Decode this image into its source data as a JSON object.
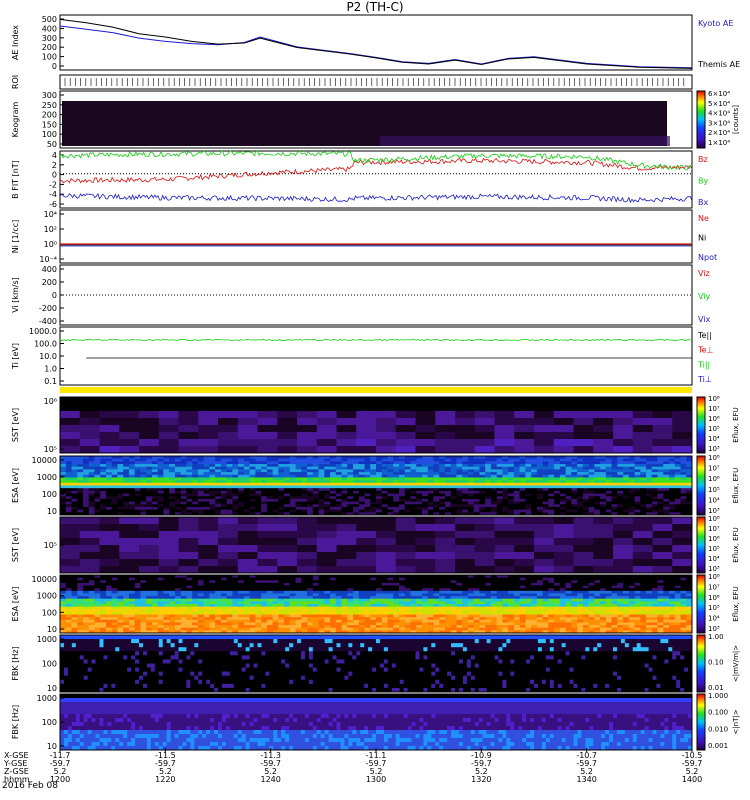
{
  "title": "P2 (TH-C)",
  "date_label": "2016 Feb 08",
  "footer": {
    "row_labels": [
      "X-GSE",
      "Y-GSE",
      "Z-GSE",
      "hhmm"
    ],
    "ticks": [
      {
        "time": "1200",
        "x": "-11.7",
        "y": "-59.7",
        "z": "5.2"
      },
      {
        "time": "1220",
        "x": "-11.5",
        "y": "-59.7",
        "z": "5.2"
      },
      {
        "time": "1240",
        "x": "-11.3",
        "y": "-59.7",
        "z": "5.2"
      },
      {
        "time": "1300",
        "x": "-11.1",
        "y": "-59.7",
        "z": "5.2"
      },
      {
        "time": "1320",
        "x": "-10.9",
        "y": "-59.7",
        "z": "5.2"
      },
      {
        "time": "1340",
        "x": "-10.7",
        "y": "-59.7",
        "z": "5.2"
      },
      {
        "time": "1400",
        "x": "-10.5",
        "y": "-59.7",
        "z": "5.2"
      }
    ]
  },
  "colors": {
    "black": "#000000",
    "blue": "#1a1ad0",
    "red": "#e01010",
    "green": "#10d010"
  },
  "chart_data": [
    {
      "id": "ae",
      "type": "line",
      "ylabel": "AE Index",
      "ylim": [
        0,
        500
      ],
      "ticks": [
        "0",
        "100",
        "200",
        "300",
        "400",
        "500"
      ],
      "legend": [
        {
          "name": "Kyoto AE",
          "color": "#1a1ad0"
        },
        {
          "name": "Themis AE",
          "color": "#000000"
        }
      ],
      "x_minutes": [
        0,
        5,
        10,
        15,
        20,
        25,
        30,
        35,
        38,
        45,
        50,
        55,
        60,
        65,
        70,
        75,
        80,
        85,
        90,
        100,
        110,
        120
      ],
      "series": [
        {
          "name": "Kyoto AE",
          "values": [
            400,
            370,
            340,
            290,
            260,
            240,
            230,
            250,
            300,
            210,
            180,
            150,
            115,
            75,
            60,
            95,
            55,
            105,
            120,
            60,
            30,
            20
          ]
        },
        {
          "name": "Themis AE",
          "values": [
            460,
            430,
            390,
            330,
            300,
            260,
            235,
            245,
            290,
            205,
            175,
            145,
            110,
            70,
            55,
            90,
            50,
            100,
            115,
            55,
            25,
            15
          ]
        }
      ]
    },
    {
      "id": "roi",
      "type": "bar",
      "ylabel": "ROI",
      "note": "tick marks only"
    },
    {
      "id": "keogram",
      "type": "heatmap",
      "ylabel": "Keogram",
      "ylim": [
        0,
        300
      ],
      "ticks": [
        "50",
        "100",
        "150",
        "200",
        "250",
        "300"
      ],
      "colorbar": {
        "label": "[counts]",
        "ticks": [
          "1×10⁴",
          "2×10⁴",
          "3×10⁴",
          "4×10⁴",
          "5×10⁴",
          "6×10⁴"
        ]
      },
      "end_minute": 120
    },
    {
      "id": "bfield",
      "type": "line",
      "ylabel": "B FIT",
      "unit": "[nT]",
      "ylim": [
        -6,
        4
      ],
      "ticks": [
        "-6",
        "-4",
        "-2",
        "0",
        "2",
        "4"
      ],
      "legend": [
        {
          "name": "Bz",
          "color": "#e01010"
        },
        {
          "name": "By",
          "color": "#10d010"
        },
        {
          "name": "Bx",
          "color": "#1a1ad0"
        }
      ],
      "x_minutes": [
        0,
        20,
        40,
        55,
        56,
        80,
        100,
        110,
        120
      ],
      "series": [
        {
          "name": "Bz",
          "values": [
            -1.2,
            -1.0,
            0.2,
            0.8,
            2.0,
            2.3,
            2.0,
            1.0,
            1.2
          ]
        },
        {
          "name": "By",
          "values": [
            3.2,
            3.5,
            3.6,
            3.5,
            2.3,
            3.2,
            3.0,
            1.5,
            1.0
          ]
        },
        {
          "name": "Bx",
          "values": [
            -3.8,
            -4.2,
            -4.3,
            -4.5,
            -4.3,
            -4.0,
            -4.2,
            -4.6,
            -4.3
          ]
        }
      ]
    },
    {
      "id": "density",
      "type": "line",
      "ylabel": "Ni",
      "unit": "[1/cc]",
      "log": true,
      "ticks": [
        "10⁻⁴",
        "10⁰",
        "10²",
        "10⁴"
      ],
      "legend": [
        {
          "name": "Ne",
          "color": "#e01010"
        },
        {
          "name": "Ni",
          "color": "#000000"
        },
        {
          "name": "Npot",
          "color": "#1a1ad0"
        }
      ],
      "values": {
        "Ne": 1,
        "Ni": 1,
        "Npot": 1
      }
    },
    {
      "id": "velocity",
      "type": "line",
      "ylabel": "Vi",
      "unit": "[km/s]",
      "ylim": [
        -500,
        500
      ],
      "ticks": [
        "-400",
        "-200",
        "0",
        "200",
        "400"
      ],
      "legend": [
        {
          "name": "Viz",
          "color": "#e01010"
        },
        {
          "name": "Viy",
          "color": "#10d010"
        },
        {
          "name": "Vix",
          "color": "#1a1ad0"
        }
      ]
    },
    {
      "id": "temperature",
      "type": "line",
      "ylabel": "Ti",
      "unit": "[eV]",
      "log": true,
      "ticks": [
        "0.1",
        "1.0",
        "10.0",
        "100.0",
        "1000.0"
      ],
      "legend": [
        {
          "name": "Te||",
          "color": "#000000"
        },
        {
          "name": "Te⊥",
          "color": "#e01010"
        },
        {
          "name": "Ti||",
          "color": "#10d010"
        },
        {
          "name": "Ti⊥",
          "color": "#1a1ad0"
        }
      ],
      "values": {
        "Ti||": 600,
        "Te||": 30
      }
    },
    {
      "id": "sst1",
      "type": "heatmap",
      "ylabel": "SST",
      "unit": "[eV]",
      "ticks": [
        "10⁵",
        "10⁶"
      ],
      "colorbar": {
        "label": "Eflux, EFU",
        "ticks": [
          "10³",
          "10⁴",
          "10⁵",
          "10⁶",
          "10⁷",
          "10⁸"
        ]
      }
    },
    {
      "id": "esa1",
      "type": "heatmap",
      "ylabel": "ESA",
      "unit": "[eV]",
      "ticks": [
        "10",
        "100",
        "1000",
        "10000"
      ],
      "colorbar": {
        "label": "Eflux, EFU",
        "ticks": [
          "10³",
          "10⁴",
          "10⁵",
          "10⁶",
          "10⁷",
          "10⁸"
        ]
      }
    },
    {
      "id": "sst2",
      "type": "heatmap",
      "ylabel": "SST",
      "unit": "[eV]",
      "ticks": [
        "10⁵"
      ],
      "colorbar": {
        "label": "Eflux, EFU",
        "ticks": [
          "10³",
          "10⁴",
          "10⁵",
          "10⁶",
          "10⁷",
          "10⁸"
        ]
      }
    },
    {
      "id": "esa2",
      "type": "heatmap",
      "ylabel": "ESA",
      "unit": "[eV]",
      "ticks": [
        "10",
        "100",
        "1000",
        "10000"
      ],
      "colorbar": {
        "label": "Eflux, EFU",
        "ticks": [
          "10³",
          "10⁴",
          "10⁵",
          "10⁶",
          "10⁷",
          "10⁸"
        ]
      }
    },
    {
      "id": "fbk1",
      "type": "heatmap",
      "ylabel": "FBK",
      "unit": "[Hz]",
      "ticks": [
        "10",
        "100",
        "1000"
      ],
      "colorbar": {
        "label": "<|mV/m|>",
        "ticks": [
          "0.01",
          "0.10",
          "1.00"
        ]
      }
    },
    {
      "id": "fbk2",
      "type": "heatmap",
      "ylabel": "FBK",
      "unit": "[Hz]",
      "ticks": [
        "10",
        "100",
        "1000"
      ],
      "colorbar": {
        "label": "<|nT|>",
        "ticks": [
          "0.001",
          "0.010",
          "0.100",
          "1.000"
        ]
      }
    }
  ]
}
